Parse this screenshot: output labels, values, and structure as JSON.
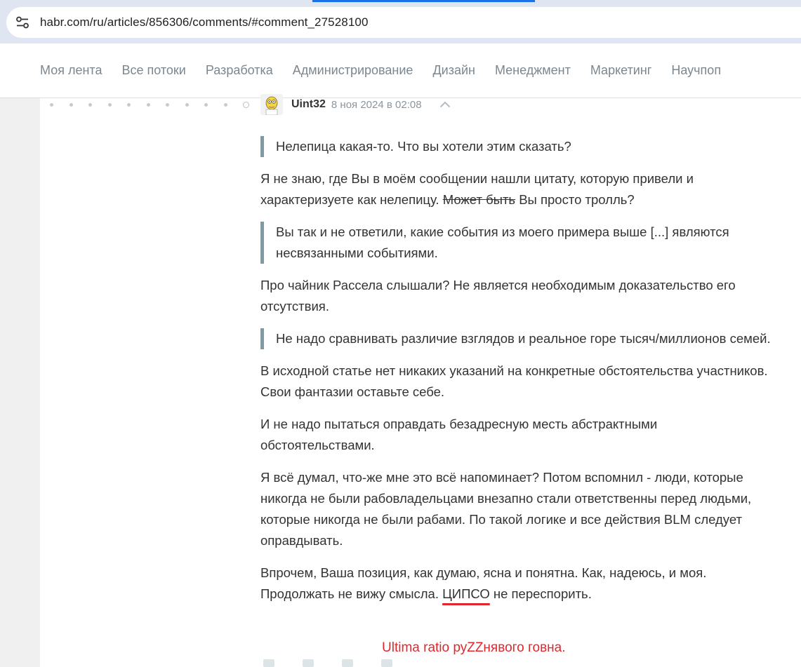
{
  "browser": {
    "url": "habr.com/ru/articles/856306/comments/#comment_27528100",
    "site_info_icon": "tune-icon"
  },
  "nav": {
    "items": [
      "Моя лента",
      "Все потоки",
      "Разработка",
      "Администрирование",
      "Дизайн",
      "Менеджмент",
      "Маркетинг",
      "Научпоп"
    ]
  },
  "comment": {
    "username": "Uint32",
    "timestamp": "8 ноя 2024 в 02:08",
    "quote1": "Нелепица какая-то. Что вы хотели этим сказать?",
    "para1_a": "Я не знаю, где Вы в моём сообщении нашли цитату, которую привели и характеризуете как нелепицу. ",
    "para1_strike": "Может быть",
    "para1_b": " Вы просто тролль?",
    "quote2": "Вы так и не ответили, какие события из моего примера выше [...] являются несвязанными событиями.",
    "para2": "Про чайник Рассела слышали? Не является необходимым доказательство его отсутствия.",
    "quote3": "Не надо сравнивать различие взглядов и реальное горе тысяч/миллионов семей.",
    "para3": "В исходной статье нет никаких указаний на конкретные обстоятельства участников. Свои фантазии оставьте себе.",
    "para4": "И не надо пытаться оправдать безадресную месть абстрактными обстоятельствами.",
    "para5": "Я всё думал, что-же мне это всё напоминает? Потом вспомнил - люди, которые никогда не были рабовладельцами внезапно стали ответственны перед людьми, которые никогда не были рабами. По такой логике и все действия BLM следует оправдывать.",
    "para6_a": "Впрочем, Ваша позиция, как думаю, ясна и понятна. Как, надеюсь, и моя. Продолжать не вижу смысла. ",
    "para6_u": "ЦИПСО",
    "para6_b": " не переспорить."
  },
  "annotation": "Ultima ratio руZZнявого говна.",
  "colors": {
    "quote_border": "#7d9ba4",
    "annotation": "#e3262c",
    "nav_text": "#7b8790"
  }
}
